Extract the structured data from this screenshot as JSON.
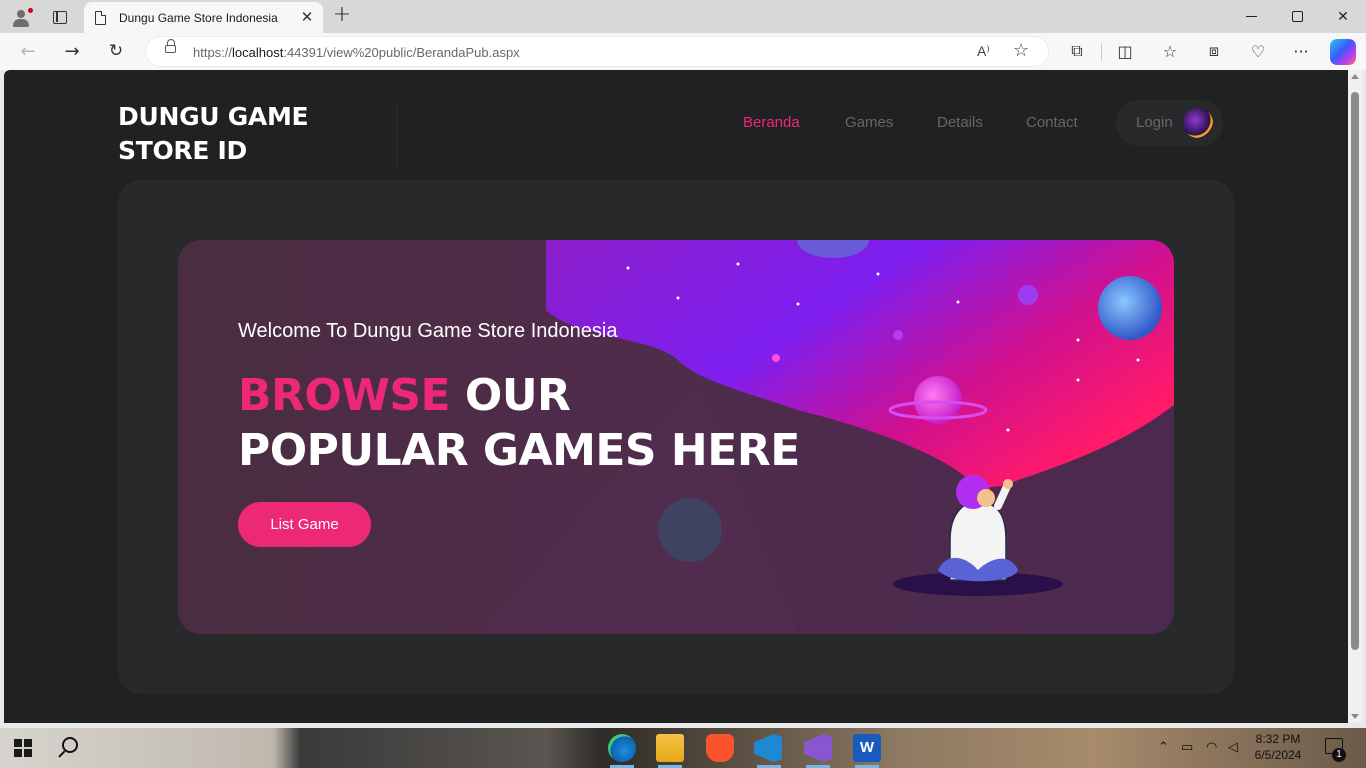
{
  "browser": {
    "tab_title": "Dungu Game Store Indonesia",
    "tab_close": "✕",
    "new_tab": "+",
    "url_prefix": "https://",
    "url_host": "localhost",
    "url_rest": ":44391/view%20public/BerandaPub.aspx",
    "read_aloud": "A⁾",
    "favorite": "☆"
  },
  "site": {
    "logo": "DUNGU GAME STORE ID",
    "nav": [
      "Beranda",
      "Games",
      "Details",
      "Contact"
    ],
    "active_nav": "Beranda",
    "login_label": "Login"
  },
  "banner": {
    "welcome": "Welcome To Dungu Game Store Indonesia",
    "headline_highlight": "BROWSE",
    "headline_rest_1": " OUR",
    "headline_line_2": "POPULAR GAMES HERE",
    "button_label": "List Game"
  },
  "taskbar": {
    "time": "8:32 PM",
    "date": "6/5/2024",
    "notification_count": "1",
    "apps": [
      "edge-icon",
      "file-explorer-icon",
      "brave-icon",
      "vscode-icon",
      "visual-studio-icon",
      "word-icon"
    ]
  },
  "colors": {
    "accent": "#ec2877",
    "page_bg": "#1f2122",
    "panel_bg": "#27292a",
    "nav_text": "#666666"
  }
}
